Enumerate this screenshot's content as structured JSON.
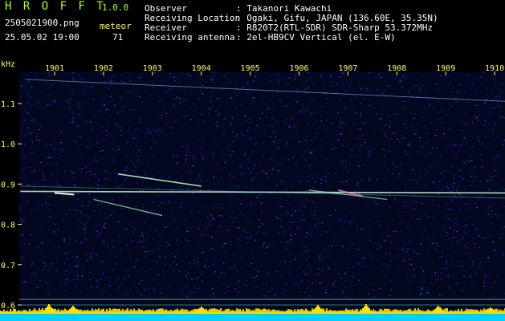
{
  "header": {
    "app_title": "H R O F F T",
    "app_version": "1.0.0",
    "filename": "2505021900.png",
    "datetime": "25.05.02 19:00",
    "meteor_label": "meteor",
    "meteor_count": "71",
    "info": [
      {
        "label": "Observer",
        "value": ": Takanori Kawachi"
      },
      {
        "label": "Receiving Location",
        "value": ": Ogaki, Gifu, JAPAN (136.60E, 35.35N)"
      },
      {
        "label": "Receiver",
        "value": ": R820T2(RTL-SDR) SDR-Sharp 53.372MHz"
      },
      {
        "label": "Receiving antenna",
        "value": ": 2el-HB9CV Vertical (el. E-W)"
      }
    ]
  },
  "chart_data": {
    "type": "heatmap",
    "ylabel": "kHz",
    "y_ticks": [
      "1.1",
      "1.0",
      "0.9",
      "0.8",
      "0.7",
      "0.6"
    ],
    "x_ticks": [
      "1901",
      "1902",
      "1903",
      "1904",
      "1905",
      "1906",
      "1907",
      "1908",
      "1909",
      "1910"
    ],
    "colors": {
      "background": "#000000",
      "noise": "#1a2fd0",
      "echo": "#c9ffd8",
      "axis_text": "#ffff55",
      "header_text": "#aaff2a",
      "bottom_bar": "#00d0ff",
      "bottom_peak": "#ffe000"
    }
  }
}
